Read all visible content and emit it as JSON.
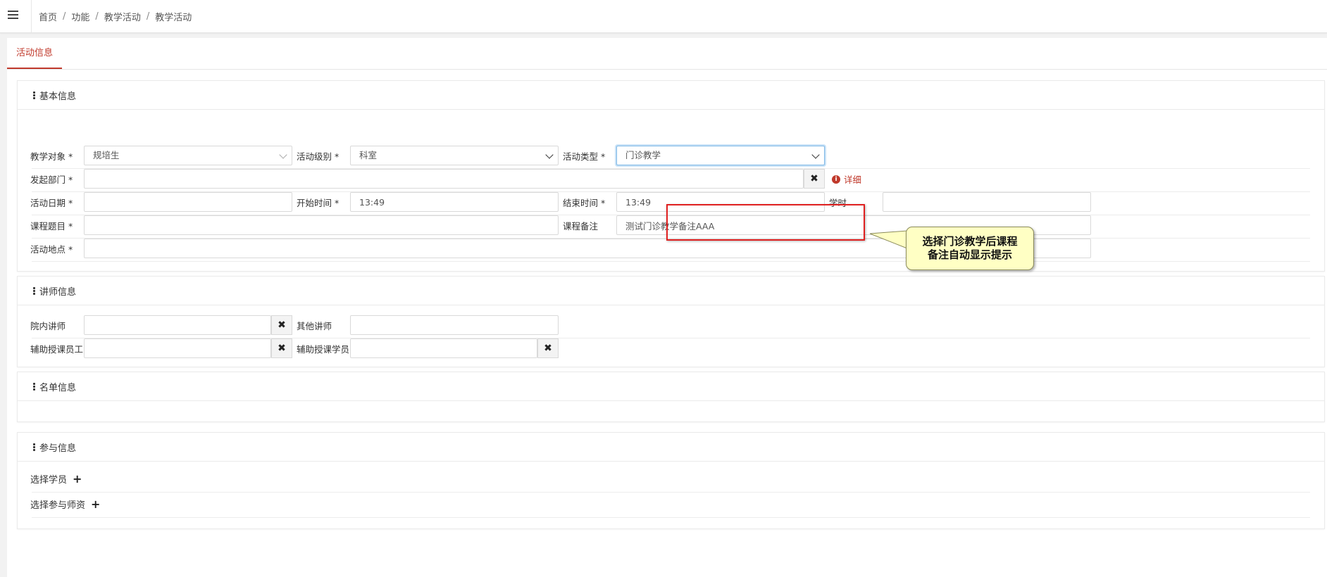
{
  "breadcrumb": [
    "首页",
    "功能",
    "教学活动",
    "教学活动"
  ],
  "tab": {
    "label": "活动信息"
  },
  "basic": {
    "title": "基本信息",
    "teach_target": {
      "label": "教学对象 *",
      "value": "规培生"
    },
    "level": {
      "label": "活动级别 *",
      "value": "科室"
    },
    "type": {
      "label": "活动类型 *",
      "value": "门诊教学"
    },
    "dept": {
      "label": "发起部门 *",
      "value": ""
    },
    "detail_link": "详细",
    "date": {
      "label": "活动日期 *",
      "value": ""
    },
    "start": {
      "label": "开始时间 *",
      "value": "13:49"
    },
    "end": {
      "label": "结束时间 *",
      "value": "13:49"
    },
    "hours": {
      "label": "学时",
      "value": ""
    },
    "topic": {
      "label": "课程题目 *",
      "value": ""
    },
    "remark": {
      "label": "课程备注",
      "value": "测试门诊教学备注AAA"
    },
    "place": {
      "label": "活动地点 *",
      "value": ""
    }
  },
  "lecturer": {
    "title": "讲师信息",
    "internal": {
      "label": "院内讲师",
      "value": ""
    },
    "other": {
      "label": "其他讲师",
      "value": ""
    },
    "assist_staff": {
      "label": "辅助授课员工",
      "value": ""
    },
    "assist_student": {
      "label": "辅助授课学员",
      "value": ""
    }
  },
  "roster": {
    "title": "名单信息"
  },
  "participants": {
    "title": "参与信息",
    "select_students": "选择学员",
    "select_teachers": "选择参与师资"
  },
  "callout": {
    "line1": "选择门诊教学后课程",
    "line2": "备注自动显示提示"
  },
  "colors": {
    "accent": "#c0392b",
    "highlight": "#e02020",
    "callout_bg": "#ffffc4"
  },
  "icons": [
    "menu-icon",
    "chevron-down-icon",
    "clear-icon",
    "info-icon",
    "plus-icon"
  ]
}
